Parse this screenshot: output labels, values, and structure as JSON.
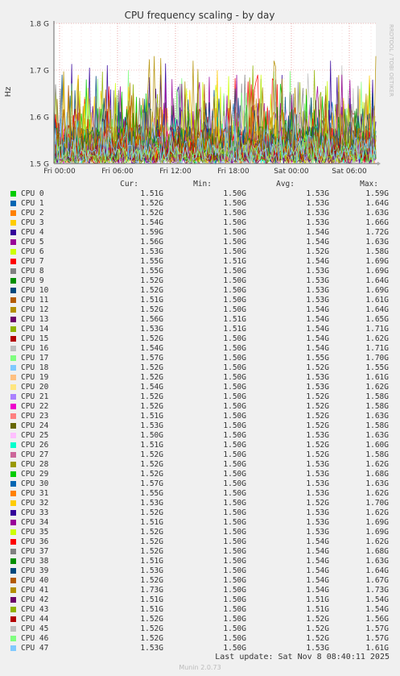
{
  "chart_data": {
    "type": "line",
    "title": "CPU frequency scaling - by day",
    "ylabel": "Hz",
    "side_label": "RRDTOOL / TOBI OETIKER",
    "ylim": [
      1.5,
      1.8
    ],
    "y_ticks": [
      "1.5 G",
      "1.6 G",
      "1.7 G",
      "1.8 G"
    ],
    "x_ticks": [
      "Fri 00:00",
      "Fri 06:00",
      "Fri 12:00",
      "Fri 18:00",
      "Sat 00:00",
      "Sat 06:00"
    ],
    "columns": [
      "Cur:",
      "Min:",
      "Avg:",
      "Max:"
    ],
    "series": [
      {
        "name": "CPU 0",
        "color": "#00cc00",
        "cur": "1.51G",
        "min": "1.50G",
        "avg": "1.53G",
        "max": "1.59G"
      },
      {
        "name": "CPU 1",
        "color": "#0066b3",
        "cur": "1.52G",
        "min": "1.50G",
        "avg": "1.53G",
        "max": "1.64G"
      },
      {
        "name": "CPU 2",
        "color": "#ff8000",
        "cur": "1.52G",
        "min": "1.50G",
        "avg": "1.53G",
        "max": "1.63G"
      },
      {
        "name": "CPU 3",
        "color": "#ffcc00",
        "cur": "1.54G",
        "min": "1.50G",
        "avg": "1.53G",
        "max": "1.66G"
      },
      {
        "name": "CPU 4",
        "color": "#330099",
        "cur": "1.59G",
        "min": "1.50G",
        "avg": "1.54G",
        "max": "1.72G"
      },
      {
        "name": "CPU 5",
        "color": "#990099",
        "cur": "1.56G",
        "min": "1.50G",
        "avg": "1.54G",
        "max": "1.63G"
      },
      {
        "name": "CPU 6",
        "color": "#ccff00",
        "cur": "1.53G",
        "min": "1.50G",
        "avg": "1.52G",
        "max": "1.58G"
      },
      {
        "name": "CPU 7",
        "color": "#ff0000",
        "cur": "1.55G",
        "min": "1.51G",
        "avg": "1.54G",
        "max": "1.69G"
      },
      {
        "name": "CPU 8",
        "color": "#808080",
        "cur": "1.55G",
        "min": "1.50G",
        "avg": "1.53G",
        "max": "1.69G"
      },
      {
        "name": "CPU 9",
        "color": "#008f00",
        "cur": "1.52G",
        "min": "1.50G",
        "avg": "1.53G",
        "max": "1.64G"
      },
      {
        "name": "CPU 10",
        "color": "#00487d",
        "cur": "1.52G",
        "min": "1.50G",
        "avg": "1.53G",
        "max": "1.69G"
      },
      {
        "name": "CPU 11",
        "color": "#b35a00",
        "cur": "1.51G",
        "min": "1.50G",
        "avg": "1.53G",
        "max": "1.61G"
      },
      {
        "name": "CPU 12",
        "color": "#b38f00",
        "cur": "1.52G",
        "min": "1.50G",
        "avg": "1.54G",
        "max": "1.64G"
      },
      {
        "name": "CPU 13",
        "color": "#6b006b",
        "cur": "1.56G",
        "min": "1.51G",
        "avg": "1.54G",
        "max": "1.65G"
      },
      {
        "name": "CPU 14",
        "color": "#8fb300",
        "cur": "1.53G",
        "min": "1.51G",
        "avg": "1.54G",
        "max": "1.71G"
      },
      {
        "name": "CPU 15",
        "color": "#b30000",
        "cur": "1.52G",
        "min": "1.50G",
        "avg": "1.54G",
        "max": "1.62G"
      },
      {
        "name": "CPU 16",
        "color": "#bebebe",
        "cur": "1.54G",
        "min": "1.50G",
        "avg": "1.54G",
        "max": "1.71G"
      },
      {
        "name": "CPU 17",
        "color": "#80ff80",
        "cur": "1.57G",
        "min": "1.50G",
        "avg": "1.55G",
        "max": "1.70G"
      },
      {
        "name": "CPU 18",
        "color": "#80c9ff",
        "cur": "1.52G",
        "min": "1.50G",
        "avg": "1.52G",
        "max": "1.55G"
      },
      {
        "name": "CPU 19",
        "color": "#ffc080",
        "cur": "1.52G",
        "min": "1.50G",
        "avg": "1.53G",
        "max": "1.61G"
      },
      {
        "name": "CPU 20",
        "color": "#ffe680",
        "cur": "1.54G",
        "min": "1.50G",
        "avg": "1.53G",
        "max": "1.62G"
      },
      {
        "name": "CPU 21",
        "color": "#aa80ff",
        "cur": "1.52G",
        "min": "1.50G",
        "avg": "1.52G",
        "max": "1.58G"
      },
      {
        "name": "CPU 22",
        "color": "#ee00cc",
        "cur": "1.52G",
        "min": "1.50G",
        "avg": "1.52G",
        "max": "1.58G"
      },
      {
        "name": "CPU 23",
        "color": "#ff8080",
        "cur": "1.51G",
        "min": "1.50G",
        "avg": "1.52G",
        "max": "1.63G"
      },
      {
        "name": "CPU 24",
        "color": "#666600",
        "cur": "1.53G",
        "min": "1.50G",
        "avg": "1.52G",
        "max": "1.58G"
      },
      {
        "name": "CPU 25",
        "color": "#ffbfff",
        "cur": "1.50G",
        "min": "1.50G",
        "avg": "1.53G",
        "max": "1.63G"
      },
      {
        "name": "CPU 26",
        "color": "#00ffcc",
        "cur": "1.51G",
        "min": "1.50G",
        "avg": "1.52G",
        "max": "1.60G"
      },
      {
        "name": "CPU 27",
        "color": "#cc6699",
        "cur": "1.52G",
        "min": "1.50G",
        "avg": "1.52G",
        "max": "1.58G"
      },
      {
        "name": "CPU 28",
        "color": "#999900",
        "cur": "1.52G",
        "min": "1.50G",
        "avg": "1.53G",
        "max": "1.62G"
      },
      {
        "name": "CPU 29",
        "color": "#00cc00",
        "cur": "1.52G",
        "min": "1.50G",
        "avg": "1.53G",
        "max": "1.68G"
      },
      {
        "name": "CPU 30",
        "color": "#0066b3",
        "cur": "1.57G",
        "min": "1.50G",
        "avg": "1.53G",
        "max": "1.63G"
      },
      {
        "name": "CPU 31",
        "color": "#ff8000",
        "cur": "1.55G",
        "min": "1.50G",
        "avg": "1.53G",
        "max": "1.62G"
      },
      {
        "name": "CPU 32",
        "color": "#ffcc00",
        "cur": "1.53G",
        "min": "1.50G",
        "avg": "1.52G",
        "max": "1.70G"
      },
      {
        "name": "CPU 33",
        "color": "#330099",
        "cur": "1.52G",
        "min": "1.50G",
        "avg": "1.53G",
        "max": "1.62G"
      },
      {
        "name": "CPU 34",
        "color": "#990099",
        "cur": "1.51G",
        "min": "1.50G",
        "avg": "1.53G",
        "max": "1.69G"
      },
      {
        "name": "CPU 35",
        "color": "#ccff00",
        "cur": "1.52G",
        "min": "1.50G",
        "avg": "1.53G",
        "max": "1.69G"
      },
      {
        "name": "CPU 36",
        "color": "#ff0000",
        "cur": "1.52G",
        "min": "1.50G",
        "avg": "1.54G",
        "max": "1.62G"
      },
      {
        "name": "CPU 37",
        "color": "#808080",
        "cur": "1.52G",
        "min": "1.50G",
        "avg": "1.54G",
        "max": "1.68G"
      },
      {
        "name": "CPU 38",
        "color": "#008f00",
        "cur": "1.51G",
        "min": "1.50G",
        "avg": "1.54G",
        "max": "1.63G"
      },
      {
        "name": "CPU 39",
        "color": "#00487d",
        "cur": "1.53G",
        "min": "1.50G",
        "avg": "1.54G",
        "max": "1.64G"
      },
      {
        "name": "CPU 40",
        "color": "#b35a00",
        "cur": "1.52G",
        "min": "1.50G",
        "avg": "1.54G",
        "max": "1.67G"
      },
      {
        "name": "CPU 41",
        "color": "#b38f00",
        "cur": "1.73G",
        "min": "1.50G",
        "avg": "1.54G",
        "max": "1.73G"
      },
      {
        "name": "CPU 42",
        "color": "#6b006b",
        "cur": "1.51G",
        "min": "1.50G",
        "avg": "1.51G",
        "max": "1.54G"
      },
      {
        "name": "CPU 43",
        "color": "#8fb300",
        "cur": "1.51G",
        "min": "1.50G",
        "avg": "1.51G",
        "max": "1.54G"
      },
      {
        "name": "CPU 44",
        "color": "#b30000",
        "cur": "1.52G",
        "min": "1.50G",
        "avg": "1.52G",
        "max": "1.56G"
      },
      {
        "name": "CPU 45",
        "color": "#bebebe",
        "cur": "1.52G",
        "min": "1.50G",
        "avg": "1.52G",
        "max": "1.57G"
      },
      {
        "name": "CPU 46",
        "color": "#80ff80",
        "cur": "1.52G",
        "min": "1.50G",
        "avg": "1.52G",
        "max": "1.57G"
      },
      {
        "name": "CPU 47",
        "color": "#80c9ff",
        "cur": "1.53G",
        "min": "1.50G",
        "avg": "1.53G",
        "max": "1.61G"
      }
    ]
  },
  "footer": {
    "last_update": "Last update: Sat Nov  8 08:40:11 2025",
    "munin": "Munin 2.0.73"
  }
}
